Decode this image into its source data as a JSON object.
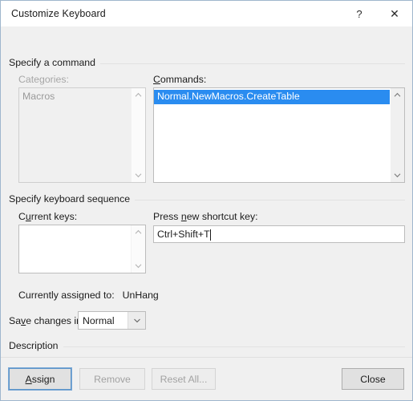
{
  "window": {
    "title": "Customize Keyboard",
    "help_button": "?",
    "close_button": "✕",
    "help_icon_name": "help-icon",
    "close_icon_name": "close-icon",
    "border_color": "#9fb6cd"
  },
  "colors": {
    "selection_blue": "#2a8cf0",
    "dialog_background": "#f0f0f0",
    "titlebar_background": "#ffffff",
    "focus_border": "#5b93c8",
    "disabled_text": "#a2a2a2"
  },
  "groups": {
    "specify_command": "Specify a command",
    "specify_keyboard_sequence": "Specify keyboard sequence",
    "description": "Description"
  },
  "categories": {
    "label_pre": "Categories:",
    "label_accel": "",
    "label_post": "",
    "enabled": false,
    "items": [
      {
        "text": "Macros",
        "selected": false
      }
    ]
  },
  "commands": {
    "label_pre": "",
    "label_accel": "C",
    "label_post": "ommands:",
    "enabled": true,
    "items": [
      {
        "text": "Normal.NewMacros.CreateTable",
        "selected": true
      }
    ]
  },
  "current_keys": {
    "label_pre": "C",
    "label_accel": "u",
    "label_post": "rrent keys:",
    "items": []
  },
  "new_shortcut": {
    "label_pre": "Press ",
    "label_accel": "n",
    "label_post": "ew shortcut key:",
    "value": "Ctrl+Shift+T",
    "placeholder": "",
    "has_caret": true
  },
  "currently_assigned": {
    "label": "Currently assigned to:",
    "value": "UnHang"
  },
  "save_changes": {
    "label_pre": "Sa",
    "label_accel": "v",
    "label_post": "e changes in:",
    "selected": "Normal",
    "options": [
      "Normal"
    ]
  },
  "description": {
    "text": ""
  },
  "footer": {
    "assign": {
      "label_pre": "",
      "label_accel": "A",
      "label_post": "ssign",
      "enabled": true,
      "focused": true
    },
    "remove": {
      "label_pre": "",
      "label_accel": "R",
      "label_post": "emove",
      "enabled": false,
      "focused": false
    },
    "reset_all": {
      "label_pre": "",
      "label_accel": "R",
      "label_post": "eset All...",
      "enabled": false,
      "focused": false
    },
    "close": {
      "label_pre": "",
      "label_accel": "",
      "label_post": "Close",
      "enabled": true,
      "focused": false
    }
  },
  "icons": {
    "scroll_up": "chevron-up-icon",
    "scroll_down": "chevron-down-icon",
    "combo_arrow": "chevron-down-icon"
  }
}
